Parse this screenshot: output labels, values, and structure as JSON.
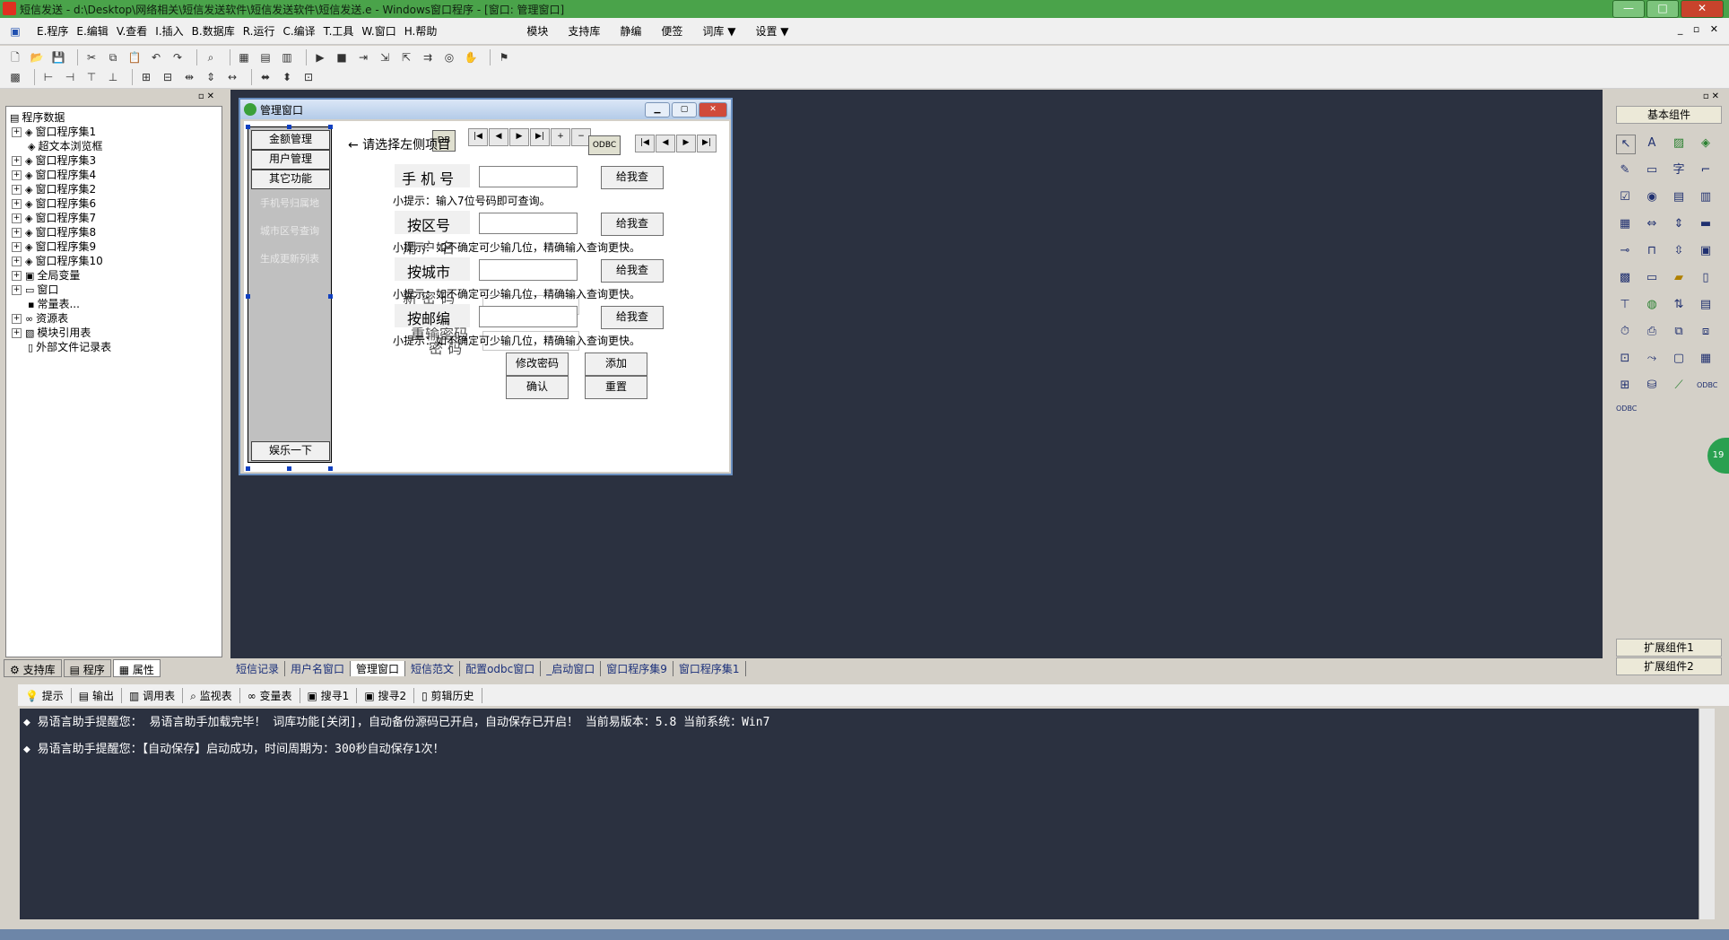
{
  "window": {
    "title": "短信发送 - d:\\Desktop\\网络相关\\短信发送软件\\短信发送软件\\短信发送.e - Windows窗口程序 - [窗口: 管理窗口]"
  },
  "menu": {
    "items": [
      "E.程序",
      "E.编辑",
      "V.查看",
      "I.插入",
      "B.数据库",
      "R.运行",
      "C.编译",
      "T.工具",
      "W.窗口",
      "H.帮助"
    ],
    "extras": [
      "模块",
      "支持库",
      "静编",
      "便签",
      "词库 ▼",
      "设置 ▼"
    ]
  },
  "tree": {
    "root": "程序数据",
    "items": [
      "窗口程序集1",
      "超文本浏览框",
      "窗口程序集3",
      "窗口程序集4",
      "窗口程序集2",
      "窗口程序集6",
      "窗口程序集7",
      "窗口程序集8",
      "窗口程序集9",
      "窗口程序集10",
      "全局变量",
      "窗口",
      "常量表...",
      "资源表",
      "模块引用表",
      "外部文件记录表"
    ]
  },
  "left_tabs": [
    "支持库",
    "程序",
    "属性"
  ],
  "design_window": {
    "title": "管理窗口",
    "sidebar_buttons": [
      "金额管理",
      "用户管理",
      "其它功能"
    ],
    "sidebar_links": [
      "手机号归属地",
      "城市区号查询",
      "生成更新列表"
    ],
    "sidebar_bottom": "娱乐一下",
    "prompt": "← 请选择左侧项目",
    "rows": [
      {
        "label": "手 机 号",
        "button": "给我查",
        "hint": "小提示：输入7位号码即可查询。"
      },
      {
        "label": "按区号",
        "button": "给我查",
        "hint": "小提示：如不确定可少输几位，精确输入查询更快。"
      },
      {
        "label": "按城市",
        "button": "给我查",
        "hint": "小提示：如不确定可少输几位，精确输入查询更快。"
      },
      {
        "label": "按邮编",
        "button": "给我查",
        "hint": "小提示：如不确定可少输几位，精确输入查询更快。"
      }
    ],
    "ghost_labels": [
      "用 户 名",
      "新 密 码",
      "重输密码",
      "密 码"
    ],
    "action_buttons": [
      "修改密码",
      "添加",
      "确认",
      "重置"
    ]
  },
  "components": {
    "basic_title": "基本组件",
    "ext1": "扩展组件1",
    "ext2": "扩展组件2"
  },
  "design_tabs": [
    "短信记录",
    "用户名窗口",
    "管理窗口",
    "短信范文",
    "配置odbc窗口",
    "_启动窗口",
    "窗口程序集9",
    "窗口程序集1"
  ],
  "output_tabs": [
    "提示",
    "输出",
    "调用表",
    "监视表",
    "变量表",
    "搜寻1",
    "搜寻2",
    "剪辑历史"
  ],
  "output_lines": [
    "易语言助手提醒您： 易语言助手加载完毕！ 词库功能[关闭]，自动备份源码已开启，自动保存已开启！ 当前易版本：5.8  当前系统：Win7",
    "易语言助手提醒您：【自动保存】启动成功，时间周期为：300秒自动保存1次！"
  ]
}
